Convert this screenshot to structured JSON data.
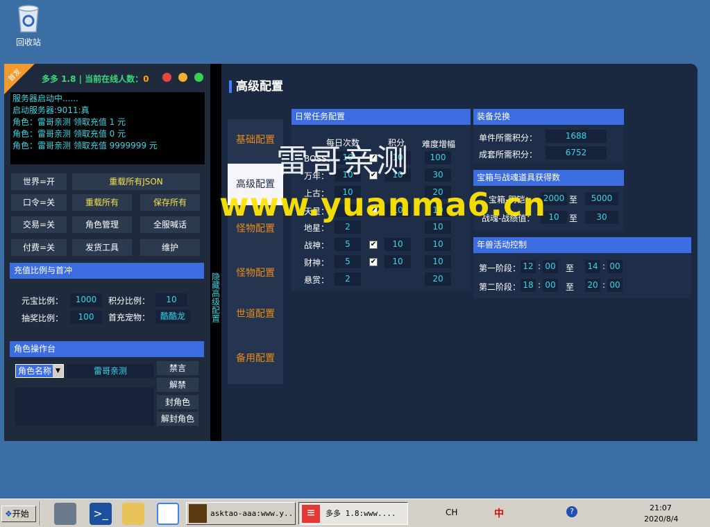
{
  "desktop": {
    "recycle_bin_label": "回收站"
  },
  "left_panel": {
    "corner_tag": "首发",
    "title": "多多 1.8 | 当前在线人数：",
    "online_count": "0",
    "log_lines": [
      "服务器启动中......",
      "启动服务器:9011:真",
      "角色：雷哥亲测 领取充值 1 元",
      "角色：雷哥亲测 领取充值 0 元",
      "角色：雷哥亲测 领取充值 9999999 元"
    ],
    "buttons": {
      "world": "世界=开",
      "reload_json": "重载所有JSON",
      "password": "口令=关",
      "reload_all": "重载所有",
      "save_all": "保存所有",
      "trade": "交易=关",
      "role_manage": "角色管理",
      "shout": "全服喊话",
      "pay": "付费=关",
      "ship_tool": "发货工具",
      "maintain": "维护"
    },
    "recharge": {
      "title": "充值比例与首冲",
      "yuanbao_label": "元宝比例：",
      "yuanbao": "1000",
      "points_label": "积分比例：",
      "points": "10",
      "lottery_label": "抽奖比例：",
      "lottery": "100",
      "first_pet_label": "首充宠物：",
      "first_pet": "酷酷龙"
    },
    "role_ops": {
      "title": "角色操作台",
      "select": "角色名称",
      "name": "雷哥亲测",
      "ban": "禁言",
      "unban": "解禁",
      "ban_role": "封角色",
      "unban_role": "解封角色"
    }
  },
  "vertical_label": "隐藏高级配置",
  "main": {
    "title": "高级配置",
    "nav": [
      "基础配置",
      "高级配置",
      "怪物配置",
      "怪物配置",
      "世道配置",
      "备用配置"
    ],
    "daily": {
      "title": "日常任务配置",
      "headers": [
        "每日次数",
        "积分",
        "难度增幅"
      ],
      "rows": [
        {
          "label": "BOSS：",
          "count": "10",
          "checked": true,
          "points": "10",
          "diff": "100"
        },
        {
          "label": "万年：",
          "count": "10",
          "checked": true,
          "points": "10",
          "diff": "30"
        },
        {
          "label": "上古：",
          "count": "10",
          "checked": false,
          "points": "",
          "diff": "20"
        },
        {
          "label": "天星：",
          "count": "5",
          "checked": true,
          "points": "10",
          "diff": "10"
        },
        {
          "label": "地星：",
          "count": "2",
          "checked": false,
          "points": "",
          "diff": "10"
        },
        {
          "label": "战神：",
          "count": "5",
          "checked": true,
          "points": "10",
          "diff": "10"
        },
        {
          "label": "财神：",
          "count": "5",
          "checked": true,
          "points": "10",
          "diff": "10"
        },
        {
          "label": "悬赏：",
          "count": "2",
          "checked": false,
          "points": "",
          "diff": "20"
        }
      ]
    },
    "equip": {
      "title": "装备兑换",
      "single_label": "单件所需积分：",
      "single": "1688",
      "set_label": "成套所需积分：",
      "set": "6752"
    },
    "chest": {
      "title": "宝箱与战魂道具获得数",
      "yinyang_label": "宝箱-阴铠：",
      "yinyang_min": "2000",
      "yinyang_max": "5000",
      "soul_label": "战魂-战绩值：",
      "soul_min": "10",
      "soul_max": "30",
      "to": "至"
    },
    "beast": {
      "title": "年兽活动控制",
      "stage1_label": "第一阶段：",
      "s1_h1": "12",
      "s1_m1": "00",
      "s1_h2": "14",
      "s1_m2": "00",
      "stage2_label": "第二阶段：",
      "s2_h1": "18",
      "s2_m1": "00",
      "s2_h2": "20",
      "s2_m2": "00",
      "to": "至",
      "colon": ":"
    }
  },
  "watermark": {
    "cn": "雷哥亲测",
    "url": "www.yuanma6.cn"
  },
  "taskbar": {
    "start": "开始",
    "task1": "asktao-aaa:www.y...",
    "task2": "多多 1.8:www....",
    "lang": "CH",
    "ime": "中",
    "time": "21:07",
    "date": "2020/8/4"
  },
  "colors": {
    "desktop": "#3a6ea5",
    "accent_blue": "#3b6de0",
    "value_cyan": "#37d7e6",
    "nav_orange": "#e88a1a"
  }
}
